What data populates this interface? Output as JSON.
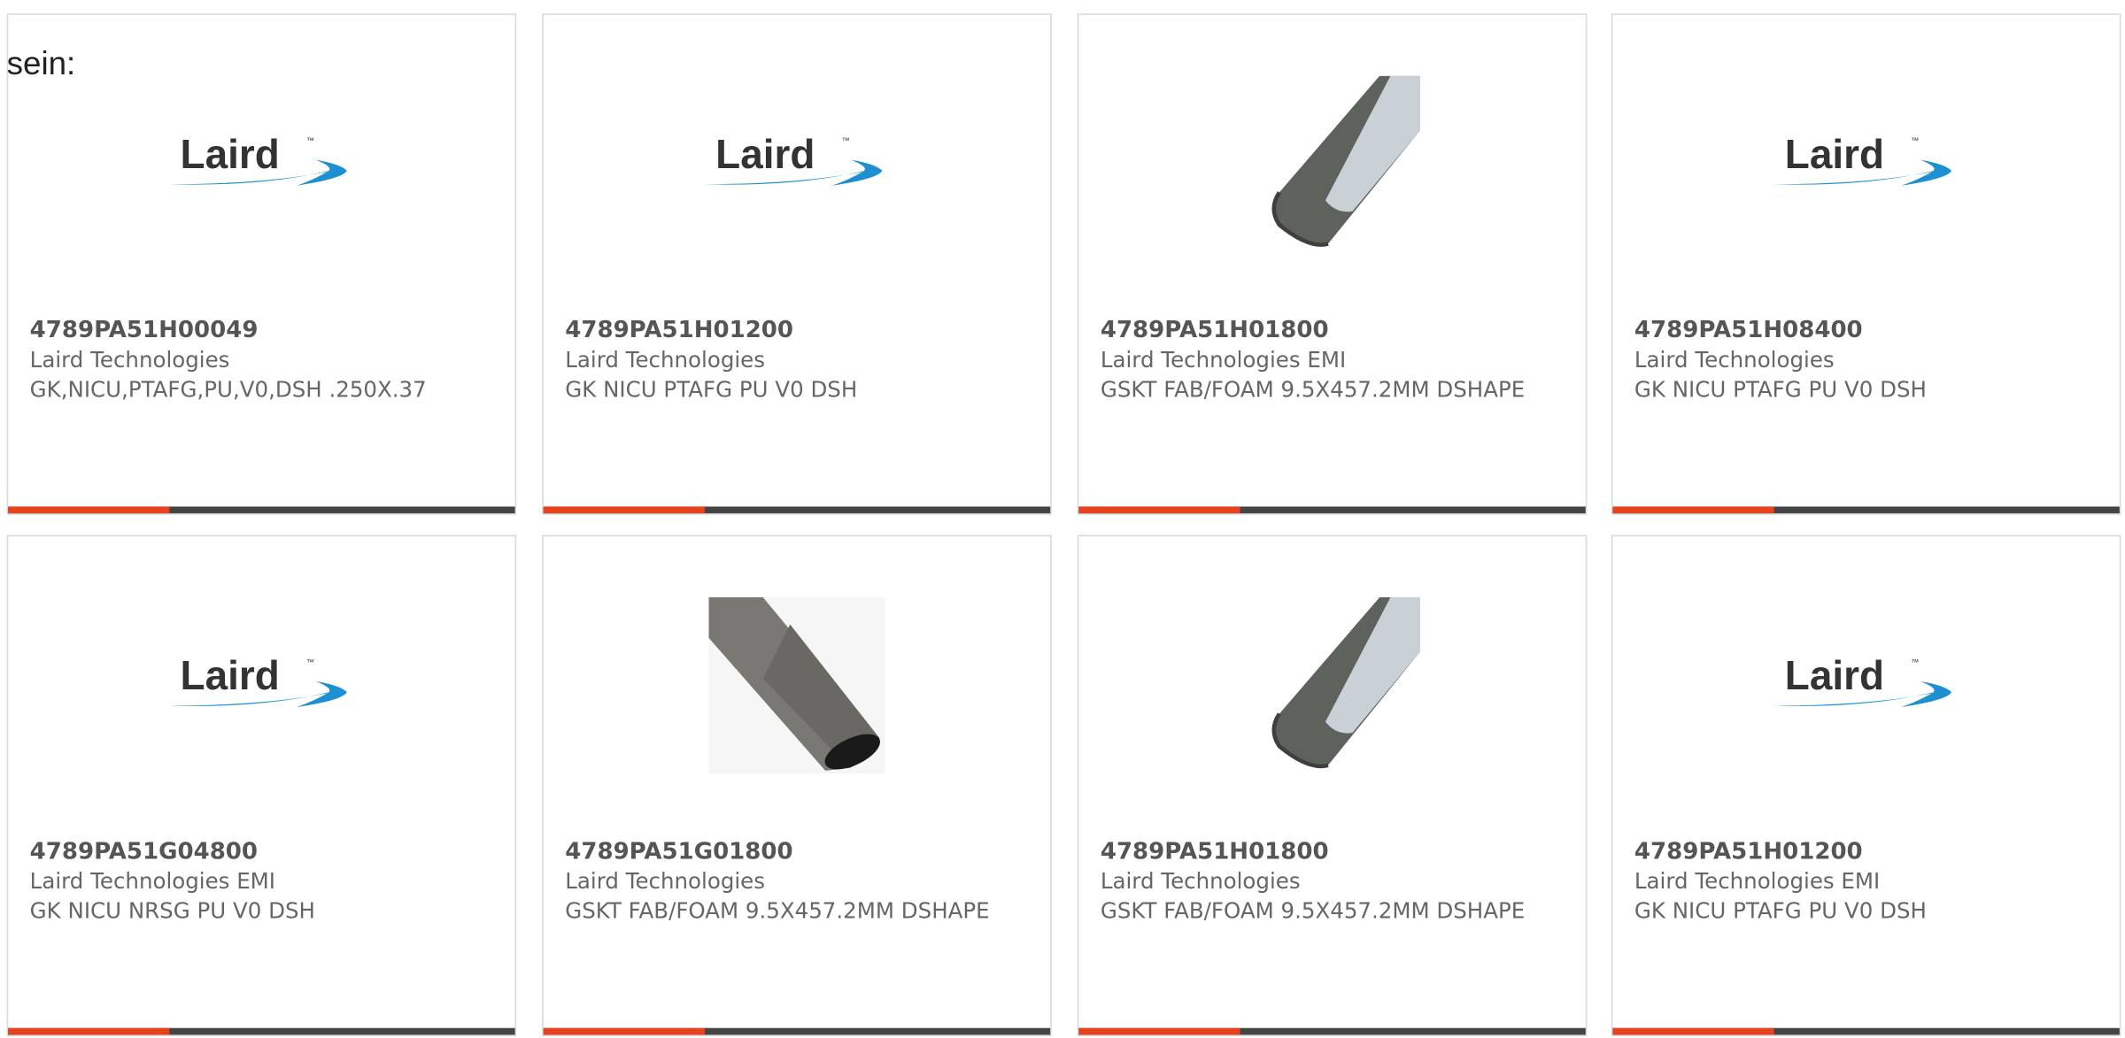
{
  "intro_text": "sein:",
  "colors": {
    "accent": "#e8411e",
    "bar": "#444444",
    "logo_text": "#333333",
    "logo_swoosh": "#1e8fd0"
  },
  "logo_text": "Laird",
  "products": [
    {
      "part_number": "4789PA51H00049",
      "manufacturer": "Laird Technologies",
      "description": "GK,NICU,PTAFG,PU,V0,DSH .250X.37",
      "image": "laird-logo"
    },
    {
      "part_number": "4789PA51H01200",
      "manufacturer": "Laird Technologies",
      "description": "GK NICU PTAFG PU V0 DSH",
      "image": "laird-logo"
    },
    {
      "part_number": "4789PA51H01800",
      "manufacturer": "Laird Technologies EMI",
      "description": "GSKT FAB/FOAM 9.5X457.2MM DSHAPE",
      "image": "gasket-photo-light"
    },
    {
      "part_number": "4789PA51H08400",
      "manufacturer": "Laird Technologies",
      "description": "GK NICU PTAFG PU V0 DSH",
      "image": "laird-logo"
    },
    {
      "part_number": "4789PA51G04800",
      "manufacturer": "Laird Technologies EMI",
      "description": "GK NICU NRSG PU V0 DSH",
      "image": "laird-logo"
    },
    {
      "part_number": "4789PA51G01800",
      "manufacturer": "Laird Technologies",
      "description": "GSKT FAB/FOAM 9.5X457.2MM DSHAPE",
      "image": "gasket-photo-dark"
    },
    {
      "part_number": "4789PA51H01800",
      "manufacturer": "Laird Technologies",
      "description": "GSKT FAB/FOAM 9.5X457.2MM DSHAPE",
      "image": "gasket-photo-light"
    },
    {
      "part_number": "4789PA51H01200",
      "manufacturer": "Laird Technologies EMI",
      "description": "GK NICU PTAFG PU V0 DSH",
      "image": "laird-logo"
    }
  ]
}
